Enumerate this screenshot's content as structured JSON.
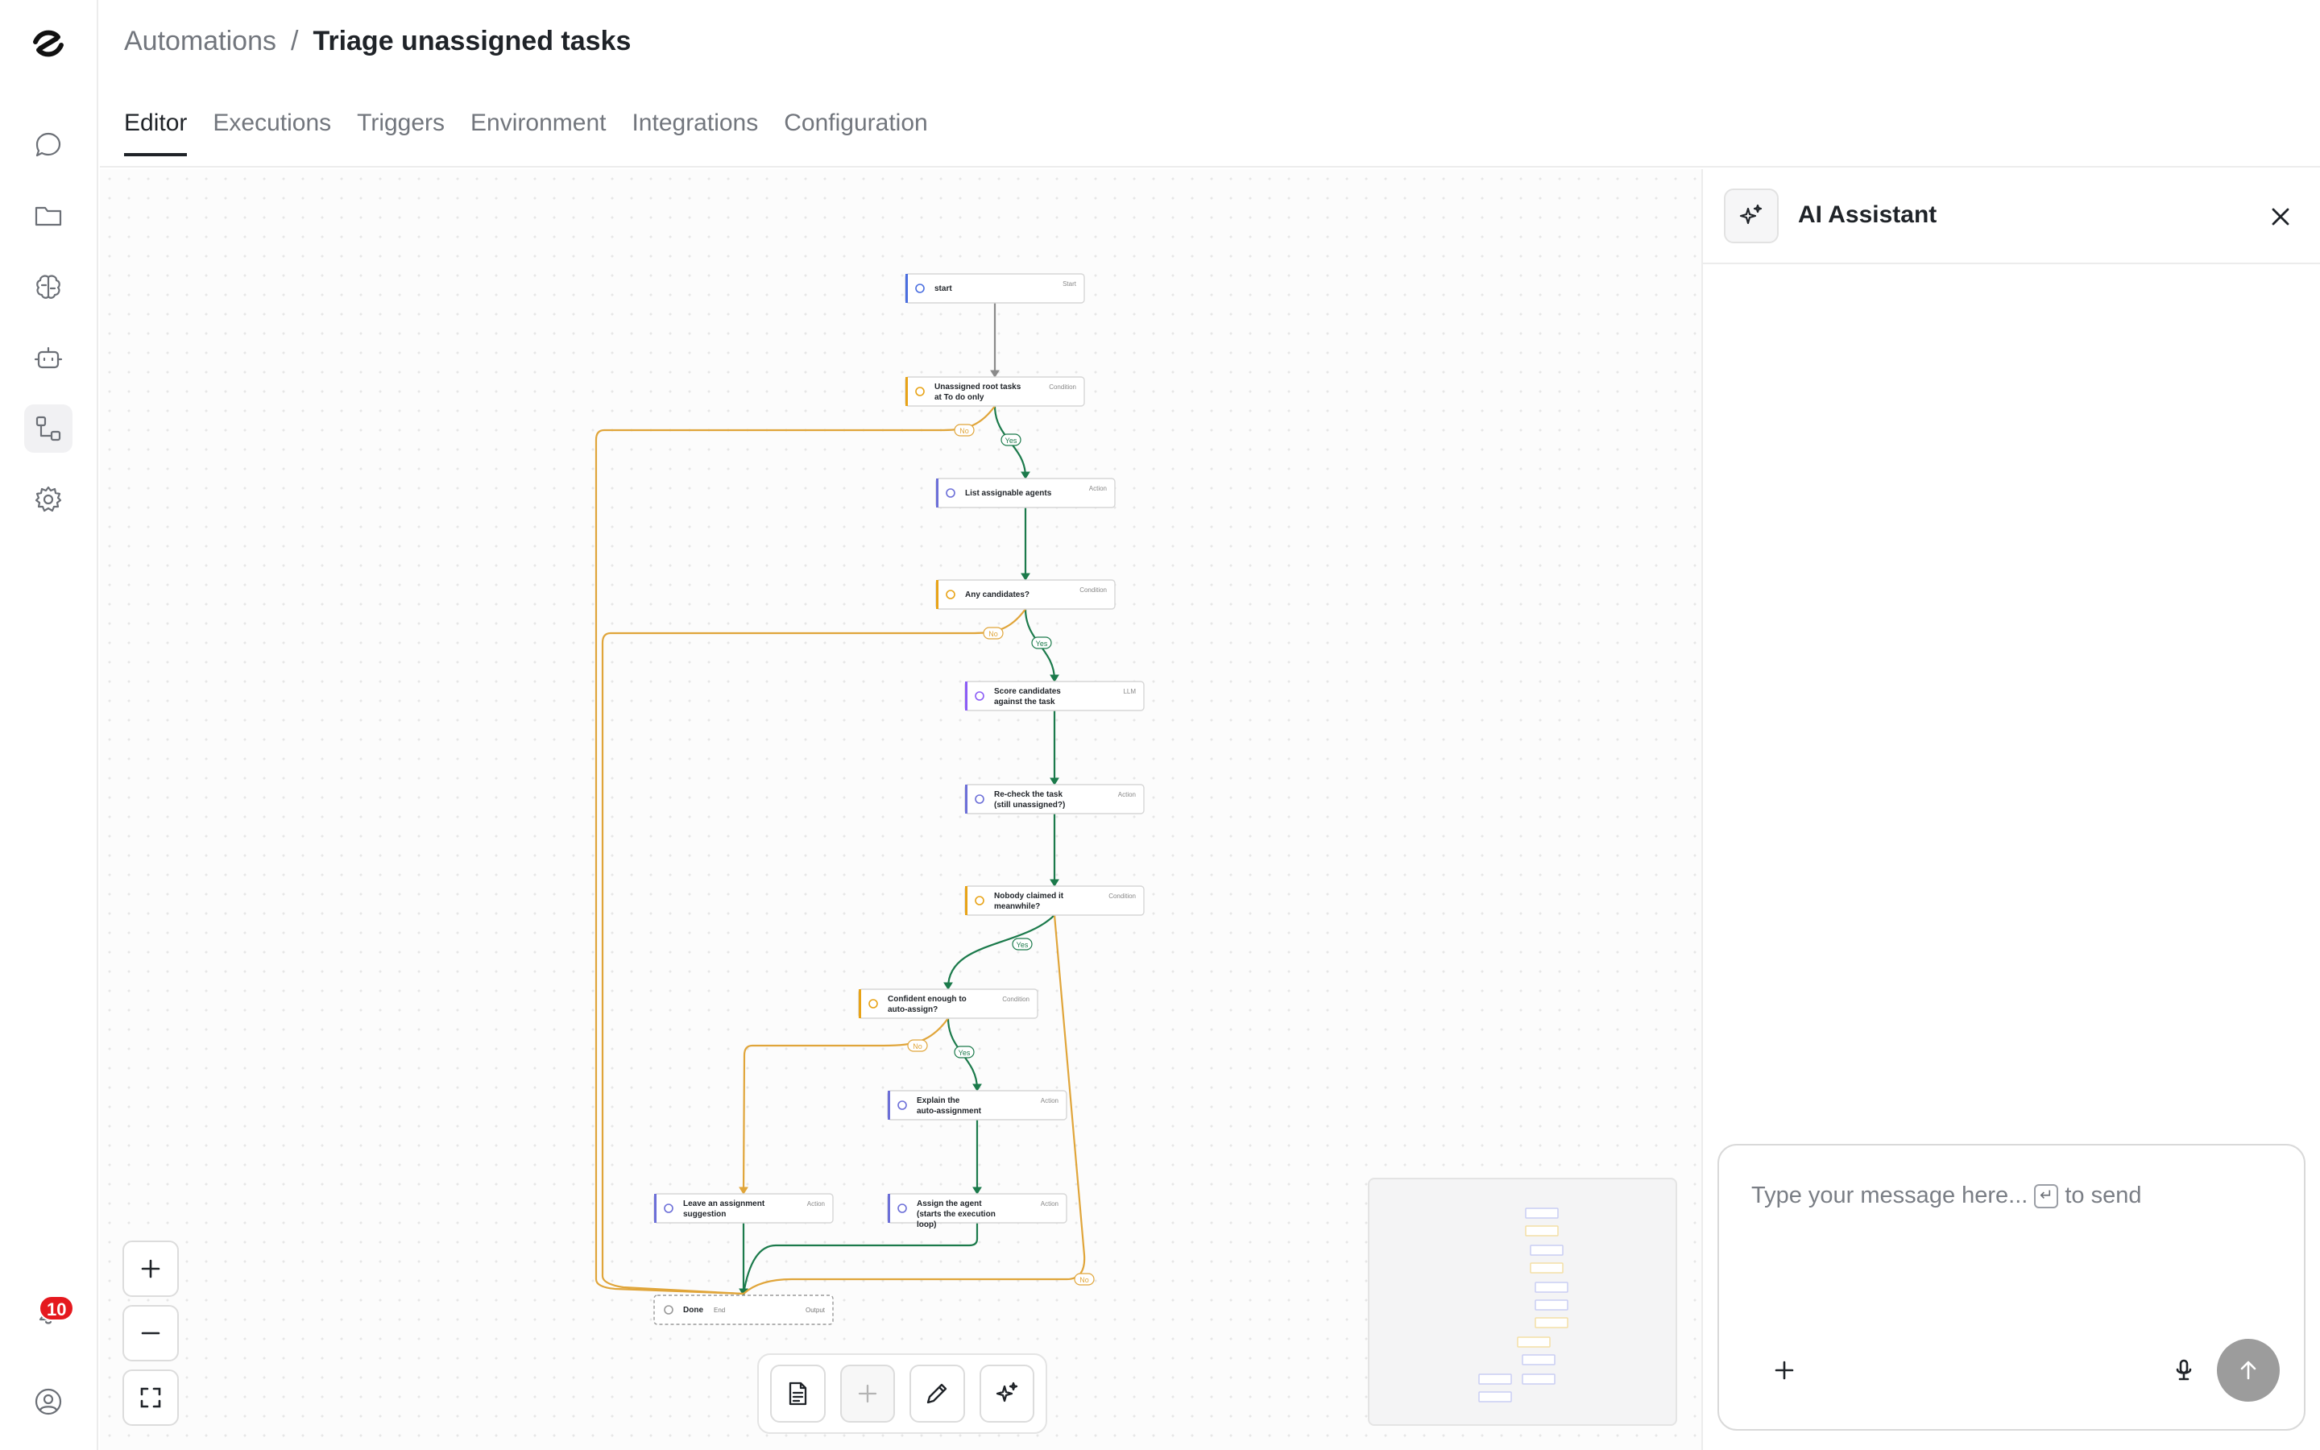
{
  "breadcrumb": {
    "parent": "Automations",
    "separator": "/",
    "current": "Triage unassigned tasks"
  },
  "tabs": [
    {
      "label": "Editor",
      "active": true
    },
    {
      "label": "Executions",
      "active": false
    },
    {
      "label": "Triggers",
      "active": false
    },
    {
      "label": "Environment",
      "active": false
    },
    {
      "label": "Integrations",
      "active": false
    },
    {
      "label": "Configuration",
      "active": false
    }
  ],
  "sidebar": {
    "items": [
      {
        "icon": "chat-bubble-icon",
        "active": false
      },
      {
        "icon": "folder-icon",
        "active": false
      },
      {
        "icon": "brain-icon",
        "active": false
      },
      {
        "icon": "robot-icon",
        "active": false
      },
      {
        "icon": "workflow-icon",
        "active": true
      },
      {
        "icon": "gear-icon",
        "active": false
      }
    ],
    "notifications_count": "10"
  },
  "workflow": {
    "nodes": [
      {
        "id": "start",
        "title": "start",
        "type": "Start",
        "kind": "start"
      },
      {
        "id": "n1",
        "title": "Unassigned root tasks at To do only",
        "type": "Condition",
        "kind": "condition"
      },
      {
        "id": "n2",
        "title": "List assignable agents",
        "type": "Action",
        "kind": "action"
      },
      {
        "id": "n3",
        "title": "Any candidates?",
        "type": "Condition",
        "kind": "condition"
      },
      {
        "id": "n4",
        "title": "Score candidates against the task",
        "type": "LLM",
        "kind": "llm"
      },
      {
        "id": "n5",
        "title": "Re-check the task (still unassigned?)",
        "type": "Action",
        "kind": "action"
      },
      {
        "id": "n6",
        "title": "Nobody claimed it meanwhile?",
        "type": "Condition",
        "kind": "condition"
      },
      {
        "id": "n7",
        "title": "Confident enough to auto-assign?",
        "type": "Condition",
        "kind": "condition"
      },
      {
        "id": "n8",
        "title": "Explain the auto-assignment",
        "type": "Action",
        "kind": "action"
      },
      {
        "id": "n9",
        "title": "Leave an assignment suggestion",
        "type": "Action",
        "kind": "action"
      },
      {
        "id": "n10",
        "title": "Assign the agent (starts the execution loop)",
        "type": "Action",
        "kind": "action"
      },
      {
        "id": "done",
        "title": "Done",
        "type": "End",
        "output": "Output",
        "kind": "end"
      }
    ],
    "edge_labels": {
      "yes": "Yes",
      "no": "No"
    }
  },
  "ai_assistant": {
    "title": "AI Assistant",
    "placeholder": "Type your message here...",
    "enter_key": "↵",
    "send_hint": "to send"
  },
  "colors": {
    "condition": "#e8a317",
    "action": "#6c6fd8",
    "llm": "#8b5cf6",
    "start": "#4a6ee0",
    "yes_edge": "#1b7a4b",
    "no_edge": "#e0a53a",
    "badge": "#e5191f"
  }
}
